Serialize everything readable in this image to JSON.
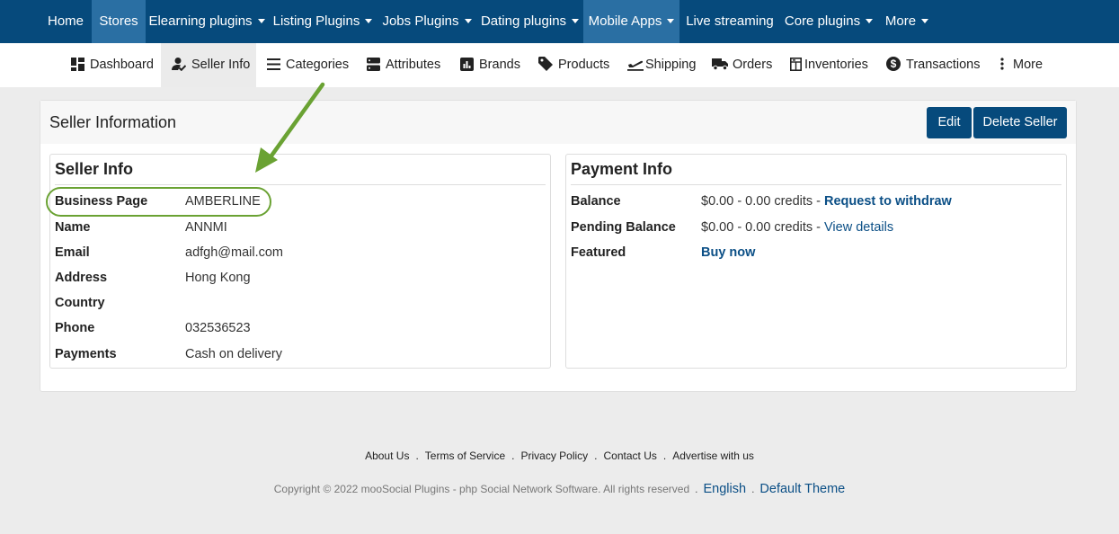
{
  "topnav": {
    "items": [
      {
        "label": "Home",
        "dropdown": false
      },
      {
        "label": "Stores",
        "dropdown": false,
        "active": true
      },
      {
        "label": "Elearning plugins",
        "dropdown": true
      },
      {
        "label": "Listing Plugins",
        "dropdown": true
      },
      {
        "label": "Jobs Plugins",
        "dropdown": true
      },
      {
        "label": "Dating plugins",
        "dropdown": true
      },
      {
        "label": "Mobile Apps",
        "dropdown": true,
        "active": true
      },
      {
        "label": "Live streaming",
        "dropdown": false
      },
      {
        "label": "Core plugins",
        "dropdown": true
      },
      {
        "label": "More",
        "dropdown": true
      }
    ]
  },
  "subnav": {
    "items": [
      {
        "label": "Dashboard",
        "icon": "dashboard-icon"
      },
      {
        "label": "Seller Info",
        "icon": "user-check-icon",
        "active": true
      },
      {
        "label": "Categories",
        "icon": "list-icon"
      },
      {
        "label": "Attributes",
        "icon": "server-icon"
      },
      {
        "label": "Brands",
        "icon": "chart-box-icon"
      },
      {
        "label": "Products",
        "icon": "tag-icon"
      },
      {
        "label": "Shipping",
        "icon": "plane-departure-icon"
      },
      {
        "label": "Orders",
        "icon": "truck-icon"
      },
      {
        "label": "Inventories",
        "icon": "cabinet-icon"
      },
      {
        "label": "Transactions",
        "icon": "dollar-circle-icon"
      },
      {
        "label": "More",
        "icon": "kebab-icon"
      }
    ]
  },
  "panel": {
    "title": "Seller Information",
    "edit_label": "Edit",
    "delete_label": "Delete Seller"
  },
  "seller_info": {
    "title": "Seller Info",
    "rows": [
      {
        "label": "Business Page",
        "value": "AMBERLINE"
      },
      {
        "label": "Name",
        "value": "ANNMI"
      },
      {
        "label": "Email",
        "value": "adfgh@mail.com"
      },
      {
        "label": "Address",
        "value": "Hong Kong"
      },
      {
        "label": "Country",
        "value": ""
      },
      {
        "label": "Phone",
        "value": "032536523"
      },
      {
        "label": "Payments",
        "value": "Cash on delivery"
      }
    ]
  },
  "payment_info": {
    "title": "Payment Info",
    "balance_label": "Balance",
    "balance_value": "$0.00 - 0.00 credits - ",
    "balance_link": "Request to withdraw",
    "pending_label": "Pending Balance",
    "pending_value": "$0.00 - 0.00 credits - ",
    "pending_link": "View details",
    "featured_label": "Featured",
    "featured_link": "Buy now"
  },
  "footer": {
    "links": [
      "About Us",
      "Terms of Service",
      "Privacy Policy",
      "Contact Us",
      "Advertise with us"
    ],
    "separator": ".",
    "copyright": "Copyright © 2022 mooSocial Plugins - php Social Network Software. All rights reserved",
    "language": "English",
    "theme": "Default Theme"
  },
  "colors": {
    "nav_bg": "#064a7c",
    "nav_active": "#2a6fa3",
    "button_bg": "#064a7c",
    "link": "#0b4f86",
    "annotation_green": "#6aa233"
  }
}
